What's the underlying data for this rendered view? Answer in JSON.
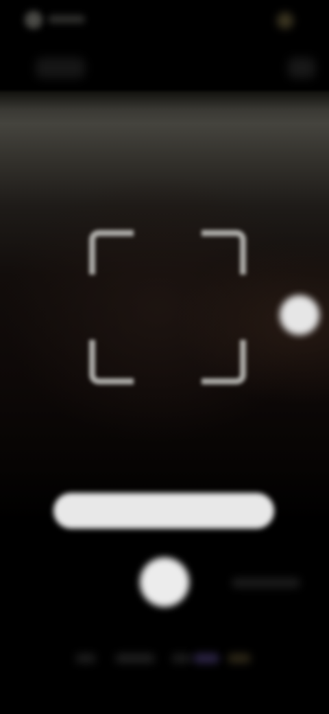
{
  "colors": {
    "background": "#000000",
    "frame_corners": "#c8c8c4",
    "controls": "#e8e8e8"
  },
  "status_bar": {
    "left_icon": "status-dot-icon",
    "right_icon": "status-dot-icon"
  },
  "top_bar": {
    "left_control": "top-left-control",
    "right_control": "top-right-control"
  },
  "viewfinder": {
    "frame_icon": "scan-frame-corners-icon",
    "side_button_icon": "circle-button-icon"
  },
  "bottom": {
    "search_bar_icon": "pill-bar",
    "shutter_icon": "shutter-circle-icon"
  },
  "mode_bar": {
    "count": 5,
    "item_icons": [
      "mode-item",
      "mode-item",
      "mode-item",
      "mode-item",
      "mode-item"
    ]
  }
}
